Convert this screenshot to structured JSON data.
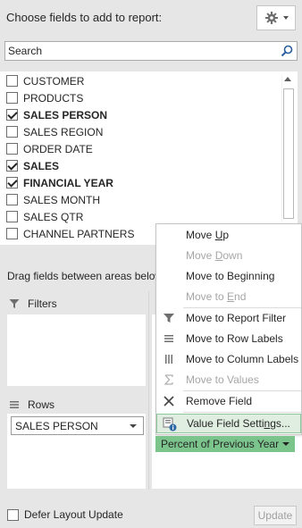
{
  "header": {
    "title": "Choose fields to add to report:",
    "tools_icon": "gear-icon"
  },
  "search": {
    "placeholder": "Search",
    "icon": "search-icon"
  },
  "fields": [
    {
      "label": "CUSTOMER",
      "checked": false
    },
    {
      "label": "PRODUCTS",
      "checked": false
    },
    {
      "label": "SALES PERSON",
      "checked": true
    },
    {
      "label": "SALES REGION",
      "checked": false
    },
    {
      "label": "ORDER DATE",
      "checked": false
    },
    {
      "label": "SALES",
      "checked": true
    },
    {
      "label": "FINANCIAL YEAR",
      "checked": true
    },
    {
      "label": "SALES MONTH",
      "checked": false
    },
    {
      "label": "SALES QTR",
      "checked": false
    },
    {
      "label": "CHANNEL PARTNERS",
      "checked": false
    }
  ],
  "drag_hint": "Drag fields between areas below",
  "areas": {
    "filters": {
      "label": "Filters",
      "icon": "filter-icon"
    },
    "rows": {
      "label": "Rows",
      "icon": "rows-icon",
      "items": [
        "SALES PERSON"
      ]
    }
  },
  "context_menu": {
    "move_up": {
      "pre": "Move ",
      "key": "U",
      "post": "p"
    },
    "move_down": {
      "pre": "Move ",
      "key": "D",
      "post": "own"
    },
    "move_to_beginning": {
      "pre": "Move to Be",
      "key": "g",
      "post": "inning"
    },
    "move_to_end": {
      "pre": "Move to ",
      "key": "E",
      "post": "nd"
    },
    "move_to_filter": {
      "pre": "Move to Report Filter",
      "key": "",
      "post": ""
    },
    "move_to_rows": {
      "pre": "Move to Row Labels",
      "key": "",
      "post": ""
    },
    "move_to_columns": {
      "pre": "Move to Column Labels",
      "key": "",
      "post": ""
    },
    "move_to_values": {
      "pre": "Move to Values",
      "key": "",
      "post": ""
    },
    "remove_field": {
      "pre": "Remove Field",
      "key": "",
      "post": ""
    },
    "value_field_settings": {
      "pre": "Value Field Setti",
      "key": "n",
      "post": "gs..."
    }
  },
  "values_chip": "Percent of Previous Year",
  "footer": {
    "defer_label": "Defer Layout Update",
    "update_label": "Update"
  },
  "colors": {
    "highlight": "#dfeee0",
    "chip": "#7bc58d"
  }
}
